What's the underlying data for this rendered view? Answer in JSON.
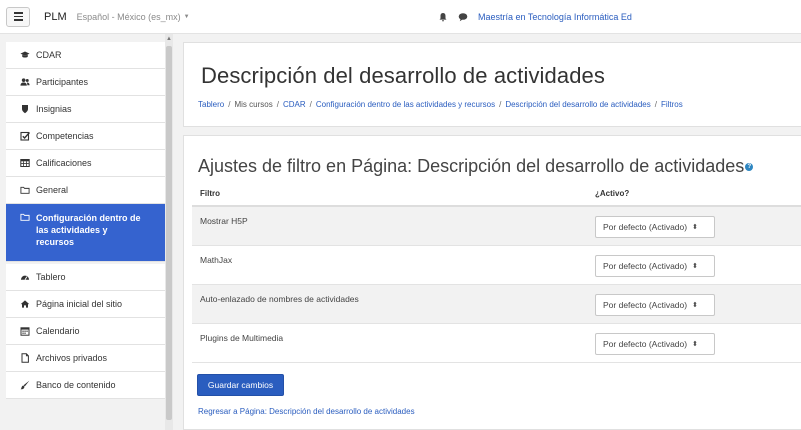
{
  "navbar": {
    "brand": "PLM",
    "language": "Español - México (es_mx)",
    "user": "Maestría en Tecnología Informática Ed"
  },
  "drawer": {
    "items": [
      {
        "label": "CDAR",
        "icon": "graduation-cap-icon"
      },
      {
        "label": "Participantes",
        "icon": "users-icon"
      },
      {
        "label": "Insignias",
        "icon": "shield-icon"
      },
      {
        "label": "Competencias",
        "icon": "checkbox-icon"
      },
      {
        "label": "Calificaciones",
        "icon": "table-icon"
      },
      {
        "label": "General",
        "icon": "folder-icon"
      },
      {
        "label": "Configuración dentro de las actividades y recursos",
        "icon": "folder-icon"
      },
      {
        "label": "Tablero",
        "icon": "tachometer-icon"
      },
      {
        "label": "Página inicial del sitio",
        "icon": "home-icon"
      },
      {
        "label": "Calendario",
        "icon": "calendar-icon"
      },
      {
        "label": "Archivos privados",
        "icon": "file-icon"
      },
      {
        "label": "Banco de contenido",
        "icon": "paint-brush-icon"
      }
    ]
  },
  "header": {
    "title": "Descripción del desarrollo de actividades",
    "breadcrumb": {
      "b0": "Tablero",
      "b1": "Mis cursos",
      "b2": "CDAR",
      "b3": "Configuración dentro de las actividades y recursos",
      "b4": "Descripción del desarrollo de actividades",
      "b5": "Filtros",
      "sep": "/"
    }
  },
  "main": {
    "section_title": "Ajustes de filtro en Página: Descripción del desarrollo de actividades",
    "table": {
      "col_filter": "Filtro",
      "col_active": "¿Activo?",
      "rows": [
        {
          "name": "Mostrar H5P",
          "value": "Por defecto (Activado)"
        },
        {
          "name": "MathJax",
          "value": "Por defecto (Activado)"
        },
        {
          "name": "Auto-enlazado de nombres de actividades",
          "value": "Por defecto (Activado)"
        },
        {
          "name": "Plugins de Multimedia",
          "value": "Por defecto (Activado)"
        }
      ]
    },
    "save_label": "Guardar cambios",
    "return_link": "Regresar a Página: Descripción del desarrollo de actividades"
  },
  "colors": {
    "accent": "#2a5dbf",
    "drawer_active": "#3563cf"
  }
}
